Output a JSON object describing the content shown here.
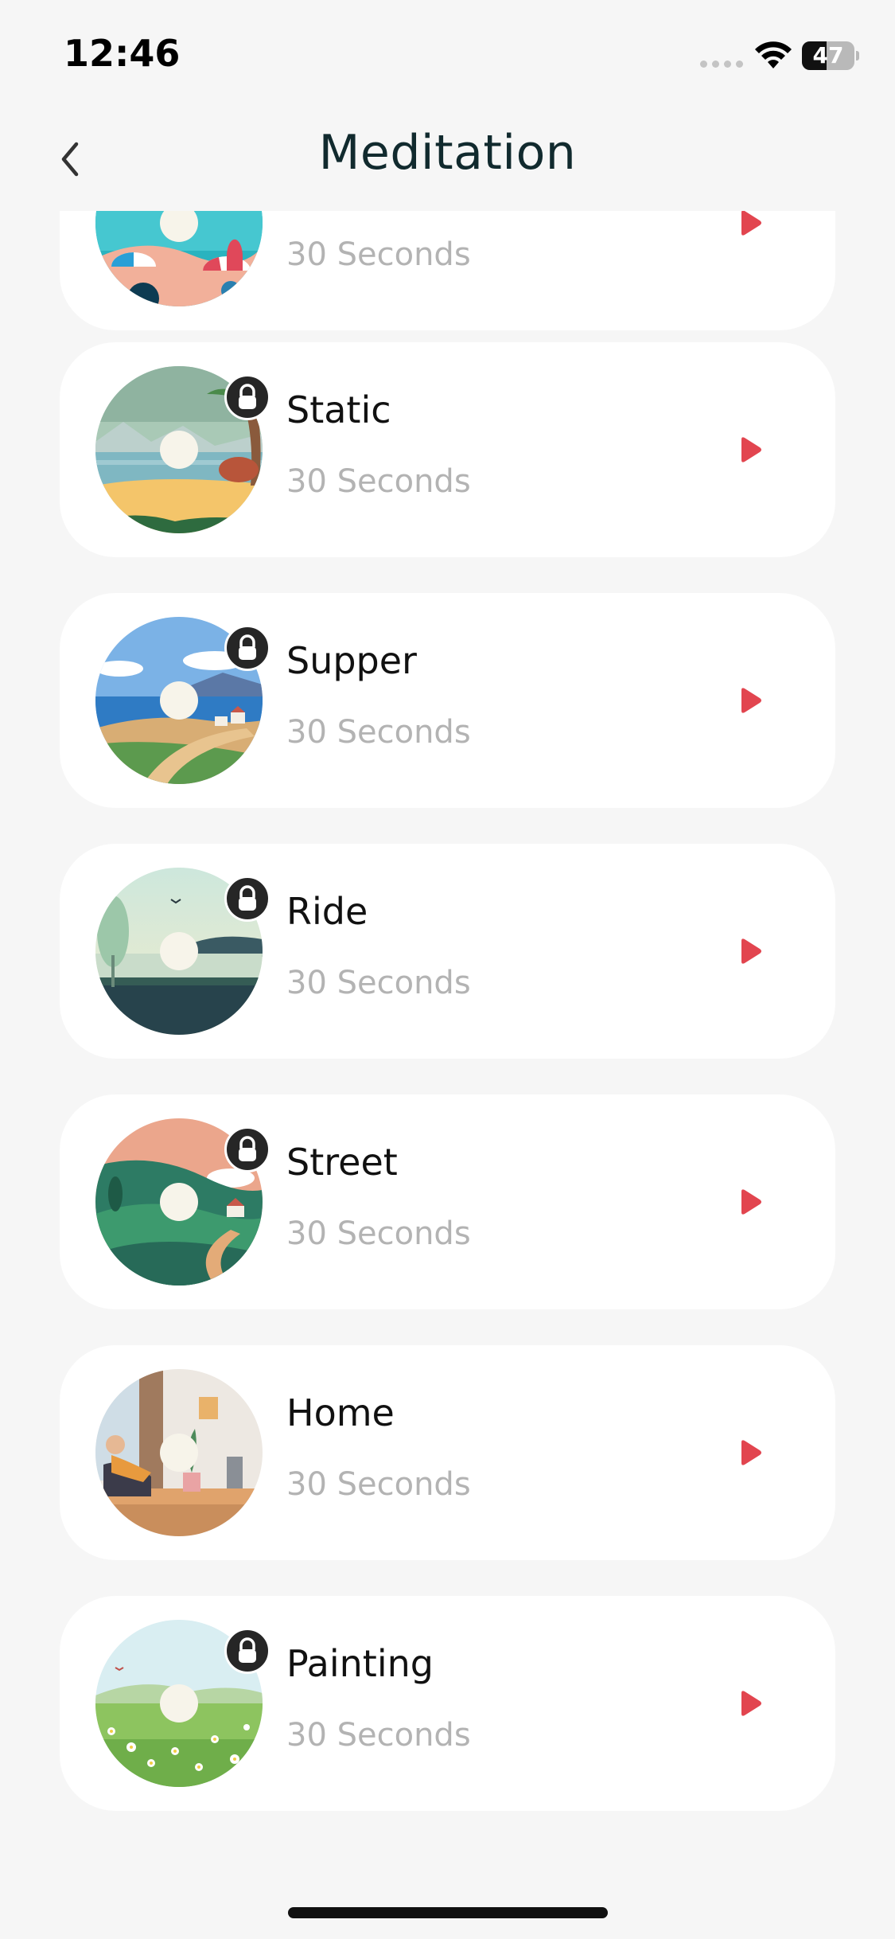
{
  "status": {
    "time": "12:46",
    "battery": "47",
    "battery_level": 0.47
  },
  "header": {
    "title": "Meditation",
    "back_icon": "chevron-left-icon"
  },
  "colors": {
    "background": "#f6f6f6",
    "card": "#ffffff",
    "accent_play": "#e2454f",
    "title": "#112a2e",
    "secondary_text": "#b3b3b3",
    "lock_badge": "#262626"
  },
  "items": [
    {
      "title": "",
      "duration": "30 Seconds",
      "locked": false,
      "scene": "beach",
      "partially_visible": true
    },
    {
      "title": "Static",
      "duration": "30 Seconds",
      "locked": true,
      "scene": "lake"
    },
    {
      "title": "Supper",
      "duration": "30 Seconds",
      "locked": true,
      "scene": "coast"
    },
    {
      "title": "Ride",
      "duration": "30 Seconds",
      "locked": true,
      "scene": "calm-lake"
    },
    {
      "title": "Street",
      "duration": "30 Seconds",
      "locked": true,
      "scene": "hills"
    },
    {
      "title": "Home",
      "duration": "30 Seconds",
      "locked": false,
      "scene": "room"
    },
    {
      "title": "Painting",
      "duration": "30 Seconds",
      "locked": true,
      "scene": "meadow"
    }
  ]
}
